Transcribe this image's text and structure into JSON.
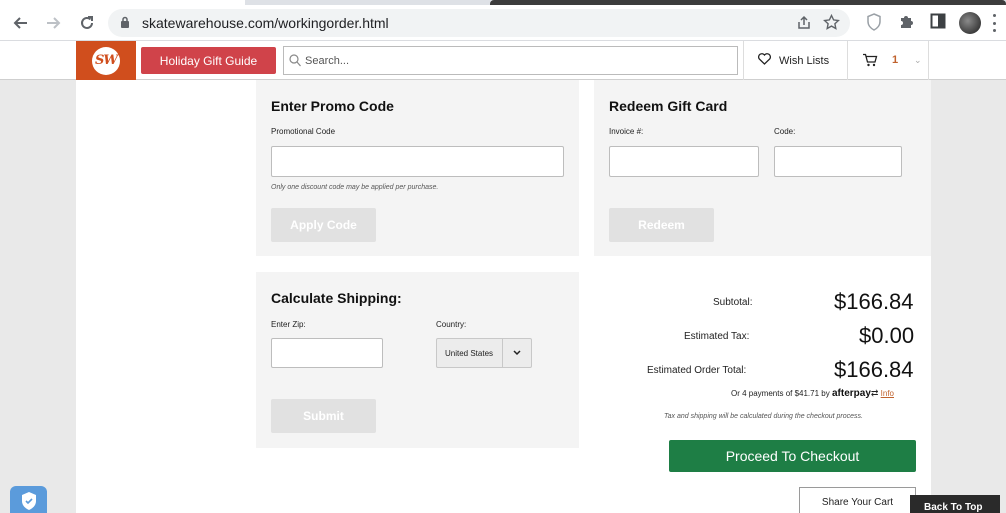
{
  "browser": {
    "url": "skatewarehouse.com/workingorder.html"
  },
  "header": {
    "logo_text": "SW",
    "gift_guide_label": "Holiday Gift Guide",
    "search_placeholder": "Search...",
    "wishlists_label": "Wish Lists",
    "cart_count": "1"
  },
  "promo": {
    "title": "Enter Promo Code",
    "field_label": "Promotional Code",
    "field_value": "",
    "note": "Only one discount code may be applied per purchase.",
    "button_label": "Apply Code"
  },
  "gift_card": {
    "title": "Redeem Gift Card",
    "invoice_label": "Invoice #:",
    "code_label": "Code:",
    "button_label": "Redeem"
  },
  "shipping": {
    "title": "Calculate Shipping:",
    "zip_label": "Enter Zip:",
    "country_label": "Country:",
    "country_value": "United States",
    "button_label": "Submit"
  },
  "summary": {
    "subtotal_label": "Subtotal:",
    "subtotal_value": "$166.84",
    "tax_label": "Estimated Tax:",
    "tax_value": "$0.00",
    "total_label": "Estimated Order Total:",
    "total_value": "$166.84",
    "afterpay_text": "Or 4 payments of $41.71 by",
    "afterpay_brand": "afterpay",
    "afterpay_info": "Info",
    "tax_note": "Tax and shipping will be calculated during the checkout process.",
    "checkout_label": "Proceed To Checkout",
    "share_cart_label": "Share Your Cart"
  },
  "back_to_top_label": "Back To Top",
  "colors": {
    "brand_orange": "#d04e1d",
    "gift_red": "#d0434a",
    "checkout_green": "#1e7e45"
  }
}
